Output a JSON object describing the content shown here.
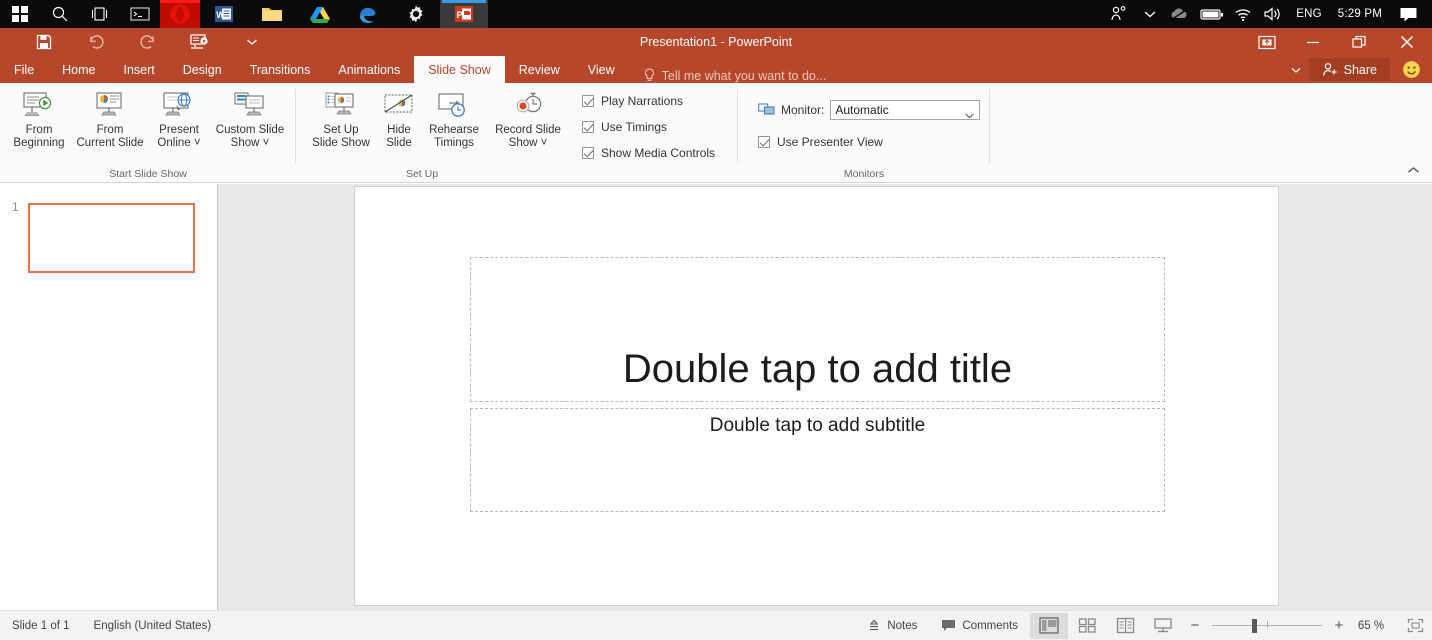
{
  "taskbar": {
    "start_label": "start-button",
    "items": [
      {
        "name": "start-button",
        "icon": "windows-logo-icon"
      },
      {
        "name": "taskbar-search",
        "icon": "search-icon"
      },
      {
        "name": "task-view",
        "icon": "task-view-icon"
      },
      {
        "name": "taskbar-cortana-box",
        "icon": "terminal-icon"
      },
      {
        "name": "taskbar-app-opera",
        "icon": "opera-icon"
      },
      {
        "name": "taskbar-app-word",
        "icon": "word-icon"
      },
      {
        "name": "taskbar-app-file-explorer",
        "icon": "folder-icon"
      },
      {
        "name": "taskbar-app-google-drive",
        "icon": "google-drive-icon"
      },
      {
        "name": "taskbar-app-edge",
        "icon": "edge-icon"
      },
      {
        "name": "taskbar-app-settings",
        "icon": "gear-icon"
      },
      {
        "name": "taskbar-app-powerpoint",
        "icon": "powerpoint-icon"
      }
    ],
    "tray": {
      "people_icon": "people-icon",
      "chevron_icon": "chevron-up-icon",
      "onedrive_icon": "cloud-icon",
      "battery_icon": "battery-icon",
      "wifi_icon": "wifi-icon",
      "volume_icon": "speaker-icon",
      "language": "ENG",
      "clock": "5:29 PM",
      "action_center_icon": "action-center-icon"
    }
  },
  "titlebar": {
    "title": "Presentation1  -  PowerPoint",
    "qat": [
      {
        "name": "save-button",
        "icon": "save-icon"
      },
      {
        "name": "undo-button",
        "icon": "undo-icon"
      },
      {
        "name": "redo-button",
        "icon": "redo-icon"
      },
      {
        "name": "start-from-beginning-button",
        "icon": "present-icon"
      },
      {
        "name": "customize-qat-button",
        "icon": "chevron-down-icon"
      }
    ],
    "window_controls": {
      "ribbon_display_options": "ribbon-display-options-icon",
      "minimize": "minimize-icon",
      "restore": "restore-icon",
      "close": "close-icon"
    }
  },
  "tabs": [
    {
      "label": "File",
      "active": false
    },
    {
      "label": "Home",
      "active": false
    },
    {
      "label": "Insert",
      "active": false
    },
    {
      "label": "Design",
      "active": false
    },
    {
      "label": "Transitions",
      "active": false
    },
    {
      "label": "Animations",
      "active": false
    },
    {
      "label": "Slide Show",
      "active": true
    },
    {
      "label": "Review",
      "active": false
    },
    {
      "label": "View",
      "active": false
    }
  ],
  "tellme": {
    "placeholder": "Tell me what you want to do..."
  },
  "share": {
    "label": "Share"
  },
  "ribbon": {
    "groups": [
      {
        "title": "Start Slide Show",
        "buttons": [
          {
            "label_line1": "From",
            "label_line2": "Beginning",
            "icon": "from-beginning-icon"
          },
          {
            "label_line1": "From",
            "label_line2": "Current Slide",
            "icon": "from-current-slide-icon"
          },
          {
            "label_line1": "Present",
            "label_line2": "Online ˅",
            "icon": "present-online-icon"
          },
          {
            "label_line1": "Custom Slide",
            "label_line2": "Show ˅",
            "icon": "custom-slide-show-icon"
          }
        ]
      },
      {
        "title": "Set Up",
        "buttons": [
          {
            "label_line1": "Set Up",
            "label_line2": "Slide Show",
            "icon": "set-up-slide-show-icon"
          },
          {
            "label_line1": "Hide",
            "label_line2": "Slide",
            "icon": "hide-slide-icon"
          },
          {
            "label_line1": "Rehearse",
            "label_line2": "Timings",
            "icon": "rehearse-timings-icon"
          },
          {
            "label_line1": "Record Slide",
            "label_line2": "Show ˅",
            "icon": "record-slide-show-icon"
          }
        ],
        "checkboxes": [
          {
            "label": "Play Narrations",
            "checked": true
          },
          {
            "label": "Use Timings",
            "checked": true
          },
          {
            "label": "Show Media Controls",
            "checked": true
          }
        ]
      },
      {
        "title": "Monitors",
        "monitor_label": "Monitor:",
        "monitor_value": "Automatic",
        "monitor_icon": "monitor-icon",
        "presenter_view": {
          "label": "Use Presenter View",
          "checked": true
        }
      }
    ],
    "collapse_icon": "chevron-up-icon"
  },
  "thumbnails": [
    {
      "number": "1",
      "selected": true
    }
  ],
  "slide": {
    "title_placeholder": "Double tap to add title",
    "subtitle_placeholder": "Double tap to add subtitle"
  },
  "statusbar": {
    "slide_count": "Slide 1 of 1",
    "language": "English (United States)",
    "notes": "Notes",
    "comments": "Comments",
    "views": [
      {
        "name": "normal-view-button",
        "icon": "normal-view-icon",
        "active": true
      },
      {
        "name": "slide-sorter-view-button",
        "icon": "slide-sorter-icon",
        "active": false
      },
      {
        "name": "reading-view-button",
        "icon": "reading-view-icon",
        "active": false
      },
      {
        "name": "slide-show-view-button",
        "icon": "slide-show-icon",
        "active": false
      }
    ],
    "zoom_out": "−",
    "zoom_in": "+",
    "zoom_level": "65 %",
    "fit_to_window_icon": "fit-to-window-icon"
  },
  "colors": {
    "accent": "#b7472a",
    "accent_dark": "#a53d22",
    "taskbar": "#0a0a0a",
    "ribbon_bg": "#fbfbfb",
    "thumb_selected_border": "#e8734a"
  }
}
